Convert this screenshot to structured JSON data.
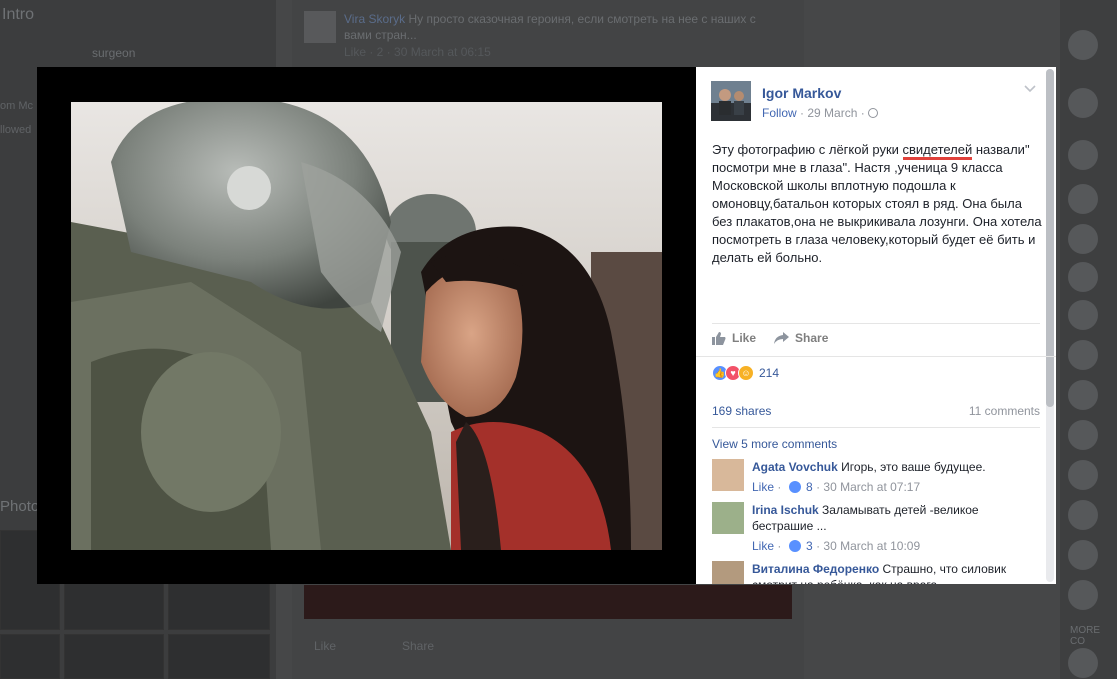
{
  "background": {
    "intro_label": "Intro",
    "surgeon_text": "surgeon",
    "left_line1": "om Mc",
    "left_line2": "llowed",
    "photos_label": "Photo",
    "vira_name": "Vira Skoryk",
    "vira_text": "Ну просто сказочная героиня, если смотреть на нее с наших с вами стран...",
    "vira_meta": "Like · 2 · 30 March at 06:15",
    "bottom_like": "Like",
    "bottom_share": "Share",
    "more_label": "MORE CO"
  },
  "post": {
    "author": "Igor Markov",
    "follow_label": "Follow",
    "date": "29 March",
    "text_before": "Эту фотографию с лёгкой руки ",
    "text_highlight": "свидетелей",
    "text_after": " назвали\" посмотри мне в глаза\". Настя ,ученица 9 класса Московской школы вплотную подошла к омоновцу,батальон которых стоял в ряд. Она была без плакатов,она не выкрикивала лозунги. Она хотела посмотреть в глаза человеку,который будет её бить и делать ей больно.",
    "like_label": "Like",
    "share_label": "Share",
    "reaction_count": "214",
    "shares": "169 shares",
    "comments_count": "11 comments",
    "view_more": "View 5 more comments"
  },
  "comments": [
    {
      "name": "Agata Vovchuk",
      "text": "Игорь, это ваше будущее.",
      "like": "Like",
      "count": "8",
      "time": "30 March at 07:17"
    },
    {
      "name": "Irina Ischuk",
      "text": "Заламывать детей -великое бестрашие ...",
      "like": "Like",
      "count": "3",
      "time": "30 March at 10:09"
    },
    {
      "name": "Виталина Федоренко",
      "text": "Страшно, что силовик смотрит на ребёнка, как на врага",
      "like": "",
      "count": "",
      "time": ""
    }
  ],
  "colors": {
    "link": "#365899",
    "accent": "#4267b2",
    "highlight_underline": "#e0413b"
  }
}
